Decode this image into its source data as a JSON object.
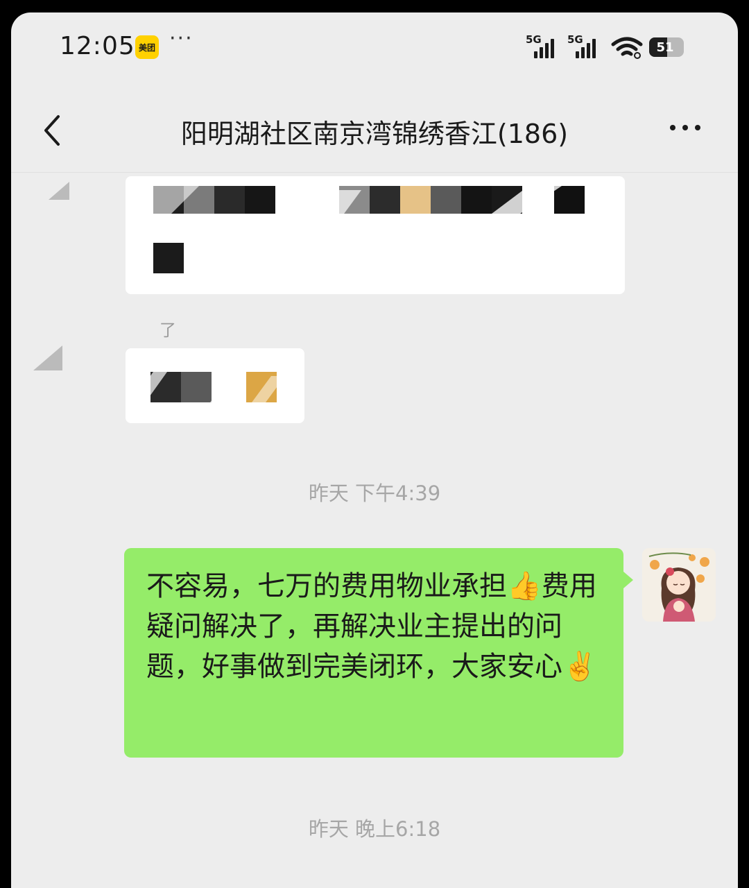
{
  "status_bar": {
    "time": "12:05",
    "app_badge": "美团",
    "more": "···",
    "network1": "5G",
    "network2": "5G",
    "battery": "51",
    "battery_level_percent": 51,
    "icons": [
      "meituan-app-icon",
      "signal-icon",
      "signal-icon",
      "wifi-icon",
      "battery-icon"
    ]
  },
  "header": {
    "title": "阳明湖社区南京湾锦绣香江(186)",
    "back_icon": "chevron-left-icon",
    "more_icon": "more-horizontal-icon"
  },
  "messages": {
    "obscured_fragment": "了",
    "timestamp_1": "昨天 下午4:39",
    "sent_message": "不容易，七万的费用物业承担👍费用疑问解决了，再解决业主提出的问题，好事做到完美闭环，大家安心✌️",
    "timestamp_2": "昨天 晚上6:18"
  },
  "colors": {
    "background": "#ededed",
    "sent_bubble": "#95ec69",
    "timestamp_text": "#a6a6a6"
  }
}
